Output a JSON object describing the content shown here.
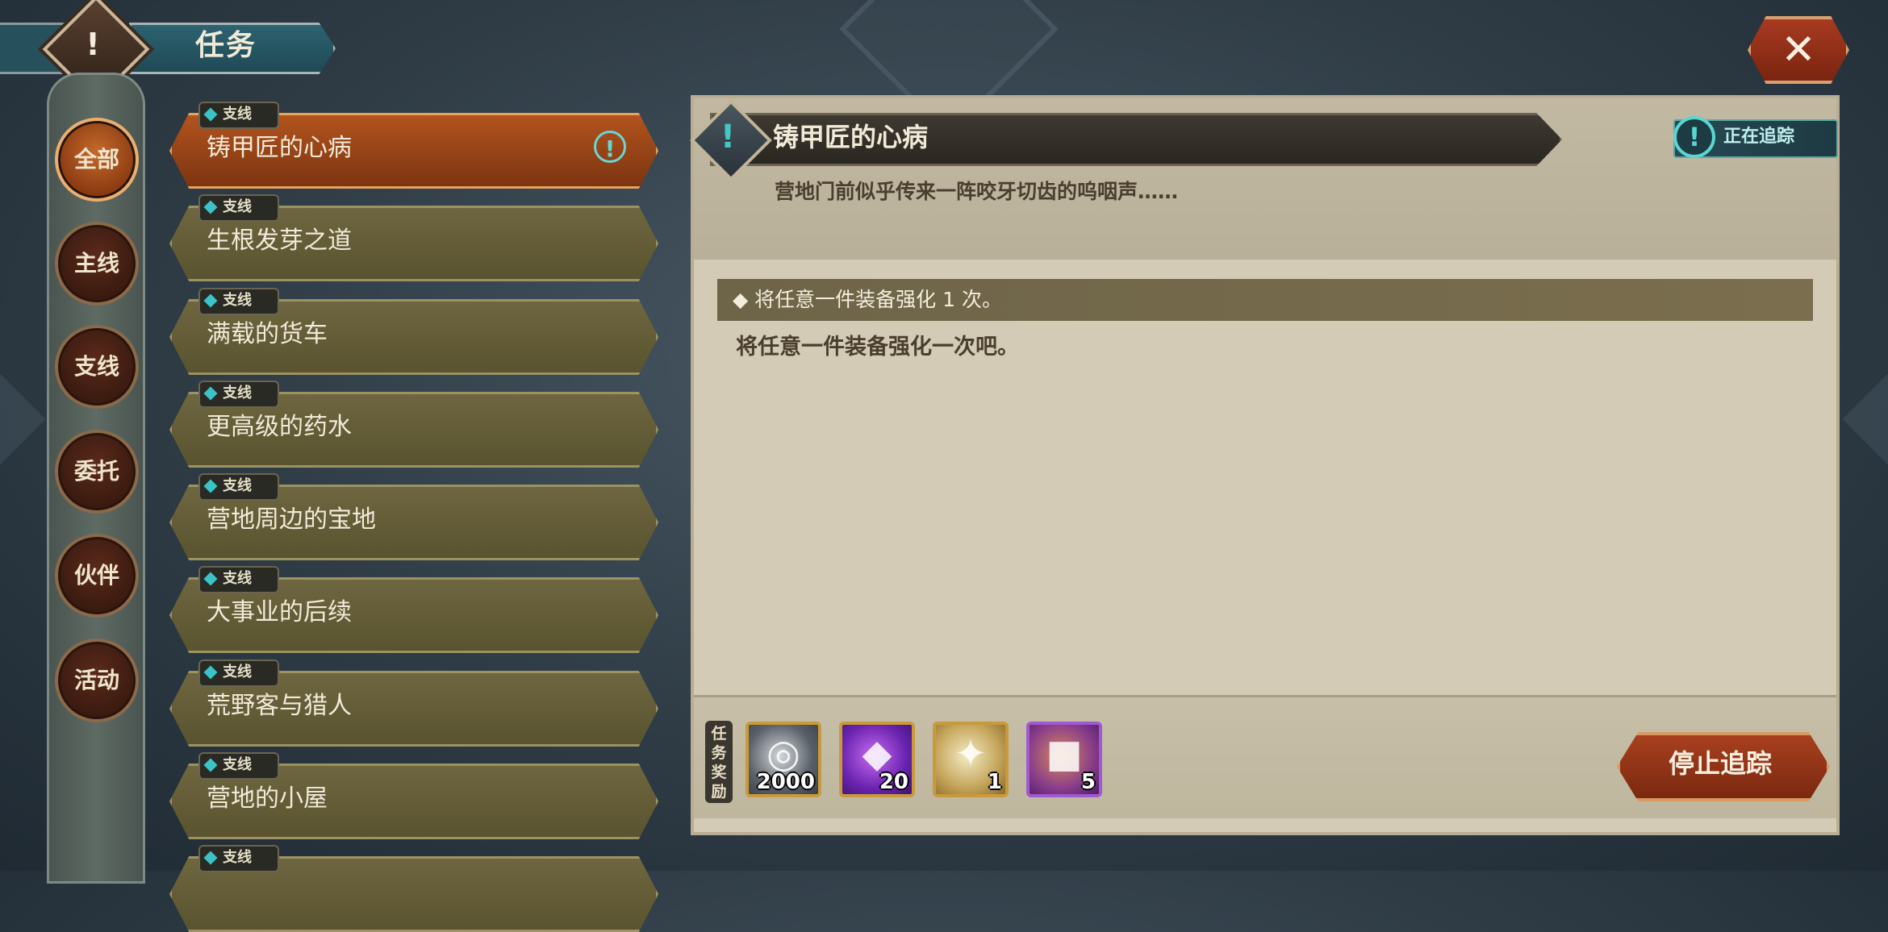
{
  "header": {
    "title": "任务"
  },
  "categories": [
    "全部",
    "主线",
    "支线",
    "委托",
    "伙伴",
    "活动"
  ],
  "quest_tag": "支线",
  "quests": [
    "铸甲匠的心病",
    "生根发芽之道",
    "满载的货车",
    "更高级的药水",
    "营地周边的宝地",
    "大事业的后续",
    "荒野客与猎人",
    "营地的小屋"
  ],
  "detail": {
    "title": "铸甲匠的心病",
    "tracking_label": "正在追踪",
    "description": "营地门前似乎传来一阵咬牙切齿的呜咽声……",
    "objective": "◆ 将任意一件装备强化 1 次。",
    "objective_detail": "将任意一件装备强化一次吧。",
    "reward_label": "任务奖励",
    "rewards": [
      {
        "icon": "silver-coin-icon",
        "qty": "2000"
      },
      {
        "icon": "purple-gem-icon",
        "qty": "20"
      },
      {
        "icon": "upgrade-scroll-icon",
        "qty": "1"
      },
      {
        "icon": "copper-ore-icon",
        "qty": "5"
      }
    ],
    "stop_button": "停止追踪"
  },
  "colors": {
    "active_quest": "#b2541e",
    "quest": "#6e6640",
    "tracking": "#5ad6d0",
    "panel": "#d3cbb6"
  }
}
